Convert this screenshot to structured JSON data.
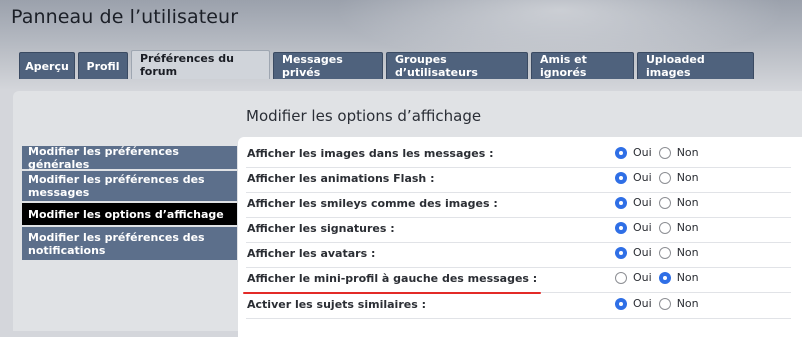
{
  "page_title": "Panneau de l’utilisateur",
  "tabs": [
    {
      "label": "Aperçu",
      "active": false
    },
    {
      "label": "Profil",
      "active": false
    },
    {
      "label": "Préférences du forum",
      "active": true
    },
    {
      "label": "Messages privés",
      "active": false
    },
    {
      "label": "Groupes d’utilisateurs",
      "active": false
    },
    {
      "label": "Amis et ignorés",
      "active": false
    },
    {
      "label": "Uploaded images",
      "active": false
    }
  ],
  "sidebar": {
    "items": [
      {
        "label": "Modifier les préférences générales",
        "active": false
      },
      {
        "label": "Modifier les préférences des messages",
        "active": false
      },
      {
        "label": "Modifier les options d’affichage",
        "active": true
      },
      {
        "label": "Modifier les préférences des notifications",
        "active": false
      }
    ]
  },
  "main": {
    "title": "Modifier les options d’affichage",
    "yes_label": "Oui",
    "no_label": "Non",
    "options": [
      {
        "label": "Afficher les images dans les messages :",
        "value": "Oui"
      },
      {
        "label": "Afficher les animations Flash :",
        "value": "Oui"
      },
      {
        "label": "Afficher les smileys comme des images :",
        "value": "Oui"
      },
      {
        "label": "Afficher les signatures :",
        "value": "Oui"
      },
      {
        "label": "Afficher les avatars :",
        "value": "Oui"
      },
      {
        "label": "Afficher le mini-profil à gauche des messages :",
        "value": "Non"
      },
      {
        "label": "Activer les sujets similaires :",
        "value": "Oui"
      }
    ]
  },
  "colors": {
    "tab_background": "#4f627d",
    "sidebar_background": "#5c6f8b",
    "sidebar_active": "#000000",
    "radio_checked": "#2f6fe6",
    "annotation_underline": "#e32a27"
  }
}
